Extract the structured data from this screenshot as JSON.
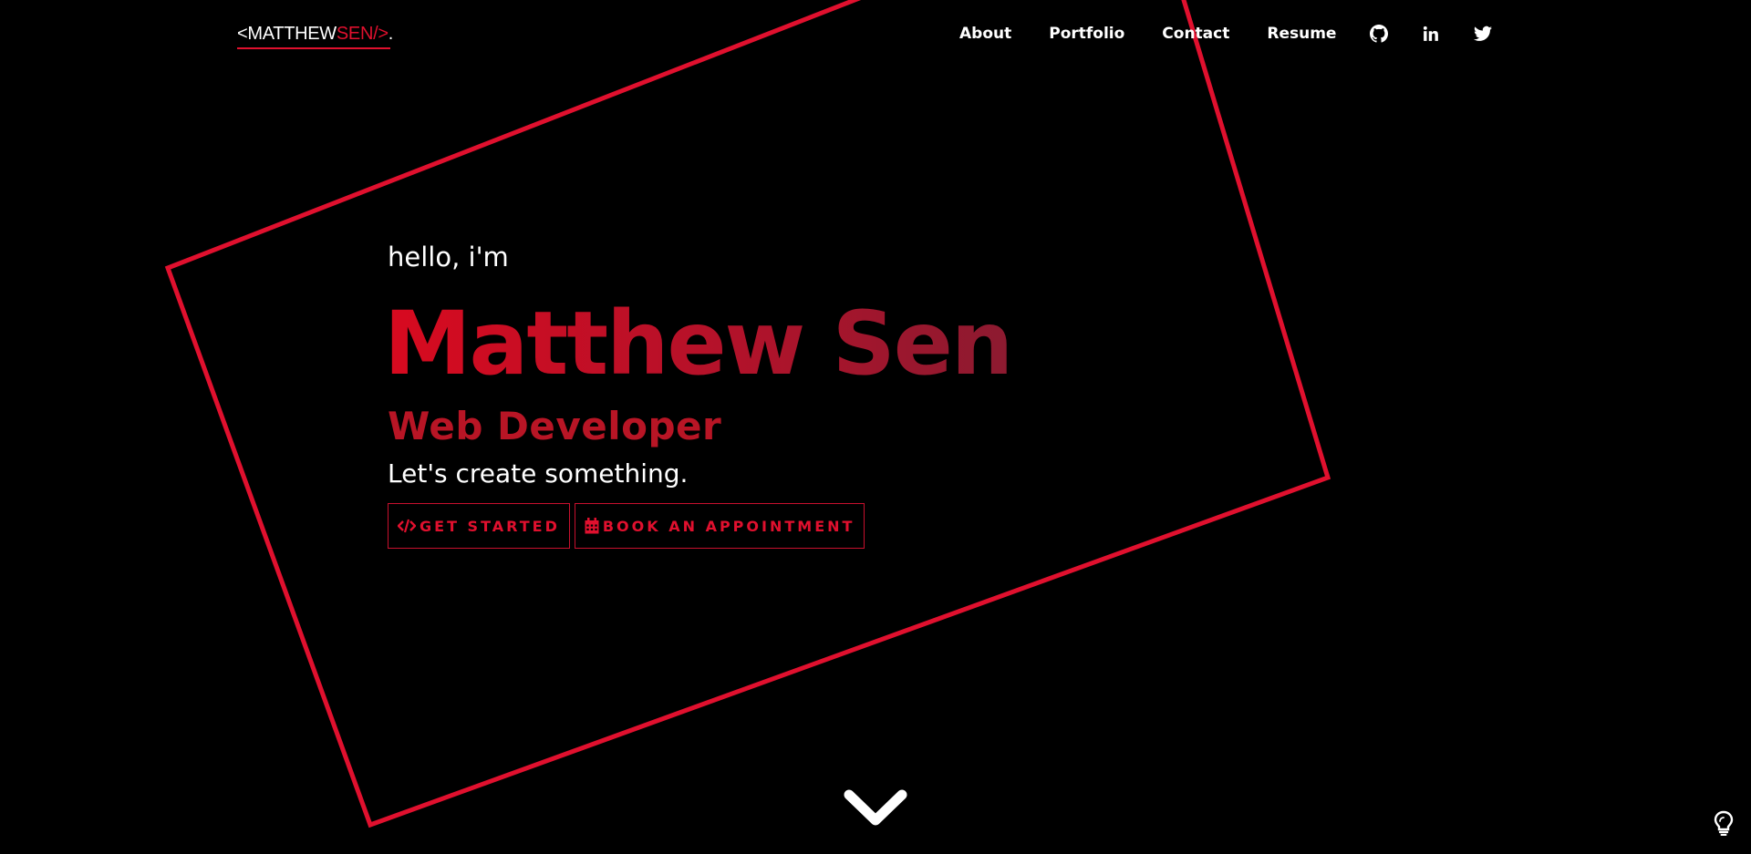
{
  "logo": {
    "prefix": "<MATTHEW",
    "accent": "SEN/>",
    "suffix": "."
  },
  "nav": {
    "links": [
      "About",
      "Portfolio",
      "Contact",
      "Resume"
    ],
    "icons": [
      "github-icon",
      "linkedin-icon",
      "twitter-icon"
    ]
  },
  "hero": {
    "greeting": "hello, i'm",
    "name": "Matthew Sen",
    "role": "Web Developer",
    "tagline": "Let's create something."
  },
  "buttons": {
    "get_started": "GET STARTED",
    "book": "BOOK AN APPOINTMENT"
  },
  "colors": {
    "background": "#000000",
    "accent": "#e0102e",
    "text": "#ffffff"
  }
}
